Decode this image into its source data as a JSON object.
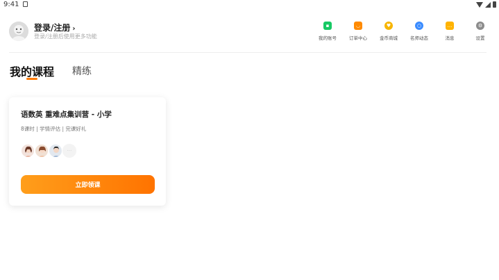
{
  "status_bar": {
    "time": "9:41"
  },
  "header": {
    "login_title": "登录/注册",
    "login_subtitle": "登录/注册后使用更多功能"
  },
  "top_icons": [
    {
      "label": "我的账号",
      "icon": "account-icon",
      "color": "#17c964"
    },
    {
      "label": "订单中心",
      "icon": "orders-icon",
      "color": "#ff8a00"
    },
    {
      "label": "金币商城",
      "icon": "coin-icon",
      "color": "#f7b500"
    },
    {
      "label": "名师动态",
      "icon": "teacher-icon",
      "color": "#3b8cff"
    },
    {
      "label": "消息",
      "icon": "message-icon",
      "color": "#ffb300"
    },
    {
      "label": "设置",
      "icon": "settings-icon",
      "color": "#8c8c8c"
    }
  ],
  "tabs": {
    "mine": "我的课程",
    "practice": "精练"
  },
  "course_card": {
    "title": "语数英 重难点集训营 - 小学",
    "meta": "8课时 | 学情评估 | 完课好礼",
    "more": "···",
    "cta": "立即领课"
  },
  "colors": {
    "accent": "#ff7a00",
    "cta_start": "#ff9e1b",
    "cta_end": "#ff7300"
  }
}
